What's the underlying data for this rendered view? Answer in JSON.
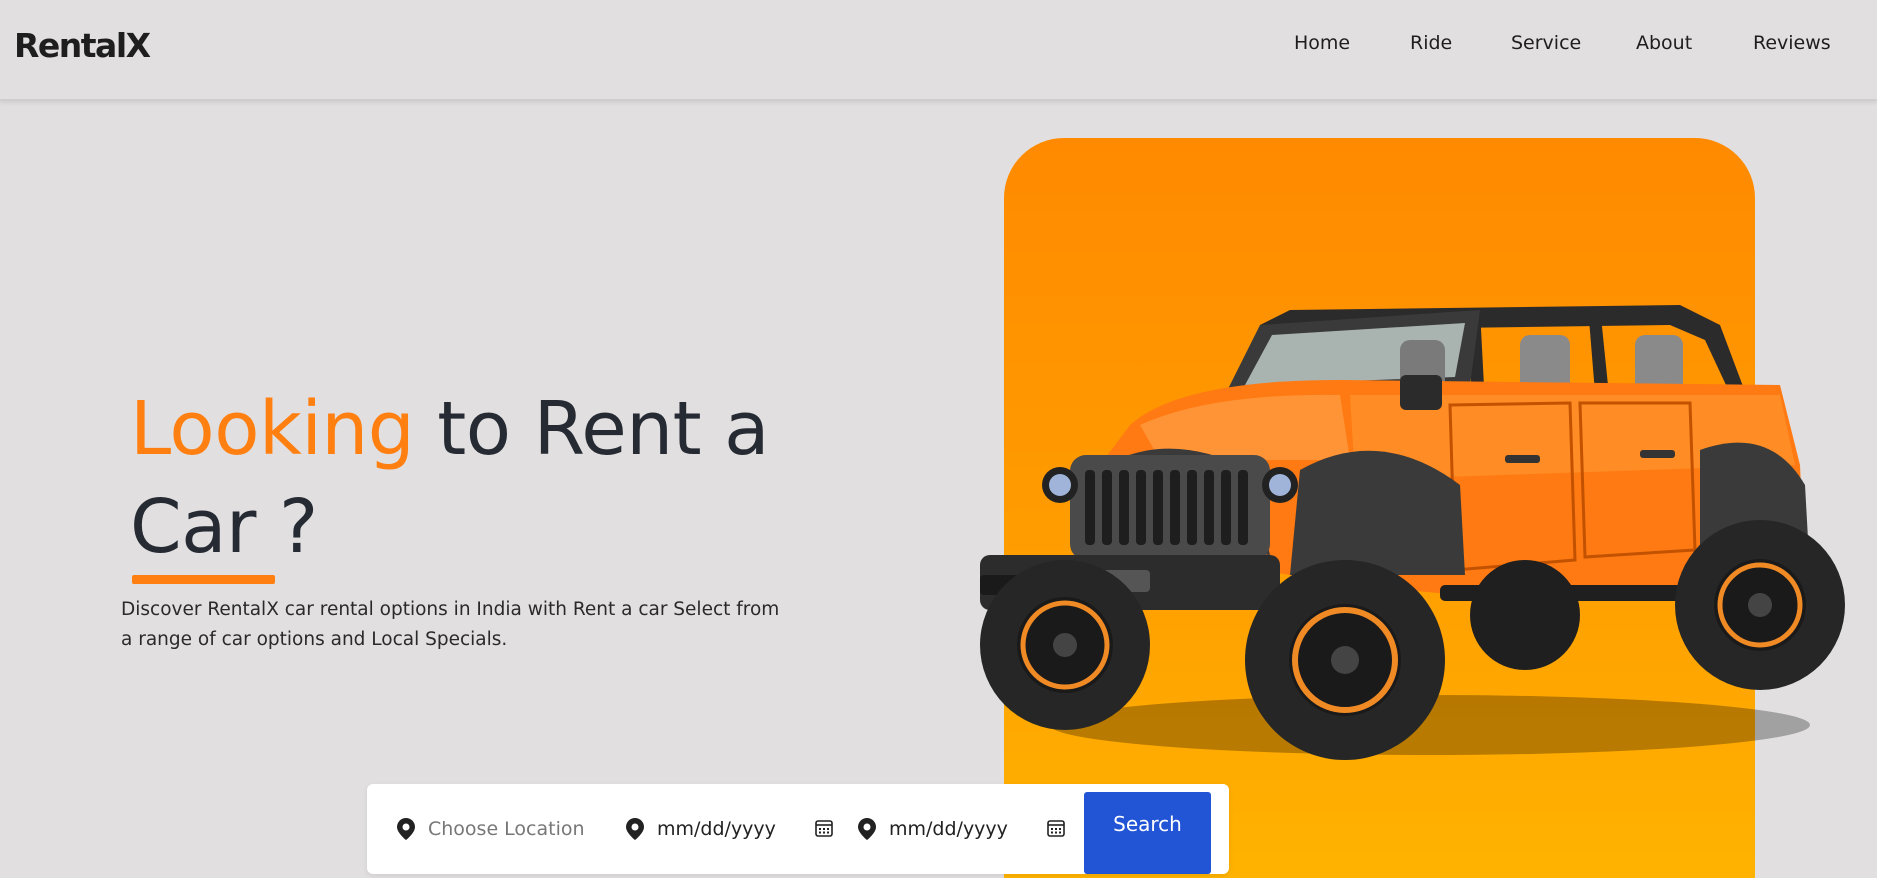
{
  "brand": "RentalX",
  "nav": [
    "Home",
    "Ride",
    "Service",
    "About",
    "Reviews"
  ],
  "hero": {
    "headline_accent": "Looking",
    "headline_rest": " to Rent a",
    "headline_line2": "Car ?",
    "description": "Discover RentalX car rental options in India with Rent a car Select from a range of car options and Local Specials."
  },
  "search": {
    "location_placeholder": "Choose Location",
    "pickup_placeholder": "mm/dd/yyyy",
    "return_placeholder": "mm/dd/yyyy",
    "button_label": "Search"
  },
  "colors": {
    "accent": "#ff7f11",
    "panel": "#ff9600",
    "button": "#2255d6",
    "background": "#e1dfdf"
  },
  "icons": [
    "map-pin-icon",
    "calendar-icon"
  ]
}
